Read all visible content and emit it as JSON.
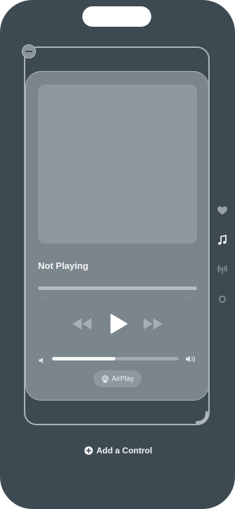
{
  "now_playing": {
    "title": "Not Playing",
    "elapsed": "-:--",
    "remaining": "--:--",
    "progress": 0,
    "volume": 0.5,
    "airplay_label": "AirPlay"
  },
  "page_rail": {
    "items": [
      "heart-icon",
      "music-note-icon",
      "antenna-icon",
      "circle-icon"
    ],
    "active": "music-note-icon"
  },
  "add_control": {
    "label": "Add a Control"
  },
  "colors": {
    "background": "#3e4a52",
    "module": "#7b858c",
    "accent": "#ffffff"
  }
}
